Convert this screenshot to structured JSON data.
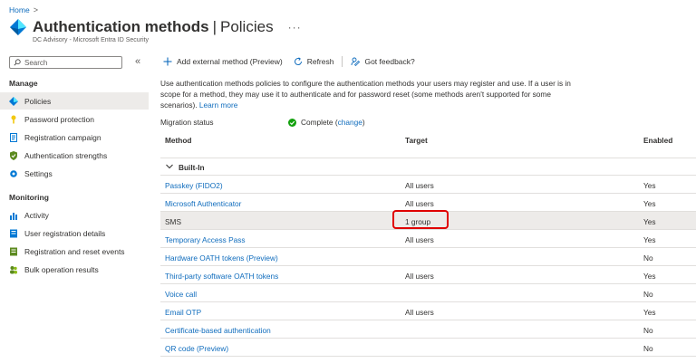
{
  "breadcrumb": {
    "home": "Home",
    "separator": ">"
  },
  "header": {
    "title_main": "Authentication methods",
    "title_separator": "|",
    "title_sub": "Policies",
    "subtitle": "DC Advisory - Microsoft Entra ID Security",
    "more": "···"
  },
  "sidebar": {
    "search_placeholder": "Search",
    "collapse": "«",
    "sections": [
      {
        "label": "Manage"
      },
      {
        "label": "Monitoring"
      }
    ],
    "manage_items": [
      {
        "label": "Policies",
        "icon": "diamond-icon",
        "active": true
      },
      {
        "label": "Password protection",
        "icon": "key-icon"
      },
      {
        "label": "Registration campaign",
        "icon": "document-icon"
      },
      {
        "label": "Authentication strengths",
        "icon": "shield-icon"
      },
      {
        "label": "Settings",
        "icon": "gear-icon"
      }
    ],
    "monitoring_items": [
      {
        "label": "Activity",
        "icon": "bar-chart-icon"
      },
      {
        "label": "User registration details",
        "icon": "user-list-icon"
      },
      {
        "label": "Registration and reset events",
        "icon": "log-icon"
      },
      {
        "label": "Bulk operation results",
        "icon": "people-icon"
      }
    ]
  },
  "toolbar": {
    "add_external": "Add external method (Preview)",
    "refresh": "Refresh",
    "feedback": "Got feedback?"
  },
  "description": {
    "text": "Use authentication methods policies to configure the authentication methods your users may register and use. If a user is in scope for a method, they may use it to authenticate and for password reset (some methods aren't supported for some scenarios).",
    "learn_more": "Learn more"
  },
  "migration": {
    "label": "Migration status",
    "status": "Complete",
    "change_open": "(",
    "change": "change",
    "change_close": ")"
  },
  "table": {
    "headers": {
      "method": "Method",
      "target": "Target",
      "enabled": "Enabled"
    },
    "group": "Built-In",
    "rows": [
      {
        "method": "Passkey (FIDO2)",
        "target": "All users",
        "enabled": "Yes"
      },
      {
        "method": "Microsoft Authenticator",
        "target": "All users",
        "enabled": "Yes"
      },
      {
        "method": "SMS",
        "target": "1 group",
        "enabled": "Yes"
      },
      {
        "method": "Temporary Access Pass",
        "target": "All users",
        "enabled": "Yes"
      },
      {
        "method": "Hardware OATH tokens (Preview)",
        "target": "",
        "enabled": "No"
      },
      {
        "method": "Third-party software OATH tokens",
        "target": "All users",
        "enabled": "Yes"
      },
      {
        "method": "Voice call",
        "target": "",
        "enabled": "No"
      },
      {
        "method": "Email OTP",
        "target": "All users",
        "enabled": "Yes"
      },
      {
        "method": "Certificate-based authentication",
        "target": "",
        "enabled": "No"
      },
      {
        "method": "QR code (Preview)",
        "target": "",
        "enabled": "No"
      }
    ]
  },
  "colors": {
    "link": "#0f6cbd",
    "selected_row": "#edebe9",
    "highlight": "#e00000",
    "success": "#13a10e"
  }
}
